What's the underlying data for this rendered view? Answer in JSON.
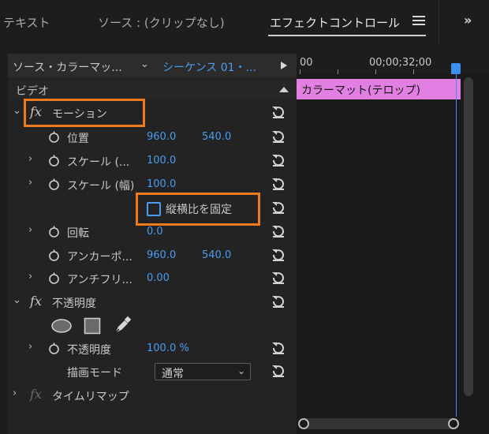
{
  "tabs": [
    {
      "label": "テキスト"
    },
    {
      "label": "ソース : (クリップなし)"
    },
    {
      "label": "エフェクトコントロール"
    }
  ],
  "header": {
    "source_label": "ソース・カラーマッ...",
    "sequence_label": "シーケンス 01・..."
  },
  "video_section": {
    "label": "ビデオ"
  },
  "motion": {
    "label": "モーション",
    "position": {
      "label": "位置",
      "x": "960.0",
      "y": "540.0"
    },
    "scale": {
      "label": "スケール (...",
      "value": "100.0"
    },
    "scale_width": {
      "label": "スケール (幅)",
      "value": "100.0"
    },
    "uniform_scale": {
      "label": "縦横比を固定",
      "checked": false
    },
    "rotation": {
      "label": "回転",
      "value": "0.0"
    },
    "anchor": {
      "label": "アンカーポ...",
      "x": "960.0",
      "y": "540.0"
    },
    "antiflicker": {
      "label": "アンチフリ...",
      "value": "0.00"
    }
  },
  "opacity": {
    "label": "不透明度",
    "value_label": "不透明度",
    "value": "100.0 %",
    "blend_label": "描画モード",
    "blend_value": "通常"
  },
  "time_remap": {
    "label": "タイムリマップ"
  },
  "timeline": {
    "start": "00",
    "timecode": "00;00;32;00",
    "clip_label": "カラーマット(テロップ)"
  },
  "colors": {
    "accent_blue": "#4a9cf0",
    "highlight_orange": "#ee7a1e",
    "clip_pink": "#e27fe2"
  }
}
